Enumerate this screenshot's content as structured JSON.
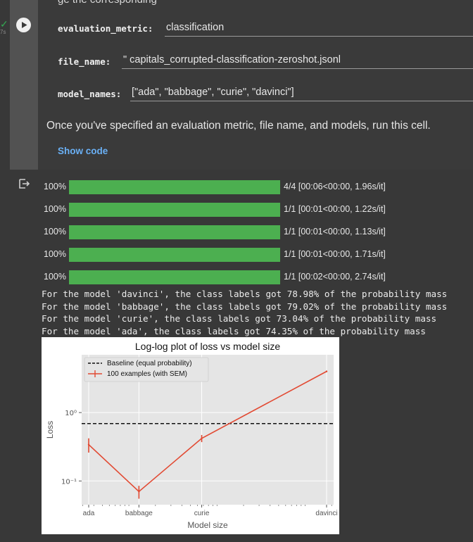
{
  "cell": {
    "top_text": "ge the corresponding",
    "exec_time": "7s",
    "params": [
      {
        "label": "evaluation_metric:",
        "value": "classification"
      },
      {
        "label": "file_name:",
        "value": "\" capitals_corrupted-classification-zeroshot.jsonl"
      },
      {
        "label": "model_names:",
        "value": "[\"ada\", \"babbage\", \"curie\", \"davinci\"]"
      }
    ],
    "instruction": "Once you've specified an evaluation metric, file name, and models, run this cell.",
    "show_code": "Show code"
  },
  "output": {
    "progress": [
      {
        "pct": "100%",
        "fraction": 1.0,
        "stat": "4/4 [00:06<00:00, 1.96s/it]"
      },
      {
        "pct": "100%",
        "fraction": 1.0,
        "stat": "1/1 [00:01<00:00, 1.22s/it]"
      },
      {
        "pct": "100%",
        "fraction": 1.0,
        "stat": "1/1 [00:01<00:00, 1.13s/it]"
      },
      {
        "pct": "100%",
        "fraction": 1.0,
        "stat": "1/1 [00:01<00:00, 1.71s/it]"
      },
      {
        "pct": "100%",
        "fraction": 1.0,
        "stat": "1/1 [00:02<00:00, 2.74s/it]"
      }
    ],
    "lines": [
      "For the model 'davinci', the class labels got 78.98% of the probability mass",
      "For the model 'babbage', the class labels got 79.02% of the probability mass",
      "For the model 'curie', the class labels got 73.04% of the probability mass",
      "For the model 'ada', the class labels got 74.35% of the probability mass"
    ]
  },
  "colors": {
    "progress_green": "#4caf50",
    "series_line": "#e24a33",
    "link": "#6ab0f5"
  },
  "chart_data": {
    "type": "line",
    "title": "Log-log plot of loss vs model size",
    "xlabel": "Model size",
    "ylabel": "Loss",
    "x_scale": "log",
    "y_scale": "log",
    "categories": [
      "ada",
      "babbage",
      "curie",
      "davinci"
    ],
    "x": [
      0.35,
      1.3,
      6.7,
      175
    ],
    "y_tick_labels": [
      "10⁰",
      "10⁻¹"
    ],
    "y_ticks": [
      1,
      0.1
    ],
    "ylim": [
      0.045,
      7
    ],
    "baseline": {
      "name": "Baseline (equal probability)",
      "value": 0.69
    },
    "series": [
      {
        "name": "100 examples (with SEM)",
        "values": [
          0.34,
          0.07,
          0.42,
          4.0
        ],
        "err": [
          0.08,
          0.015,
          0.05,
          0.1
        ]
      }
    ],
    "legend": "top-left",
    "grid": true
  }
}
